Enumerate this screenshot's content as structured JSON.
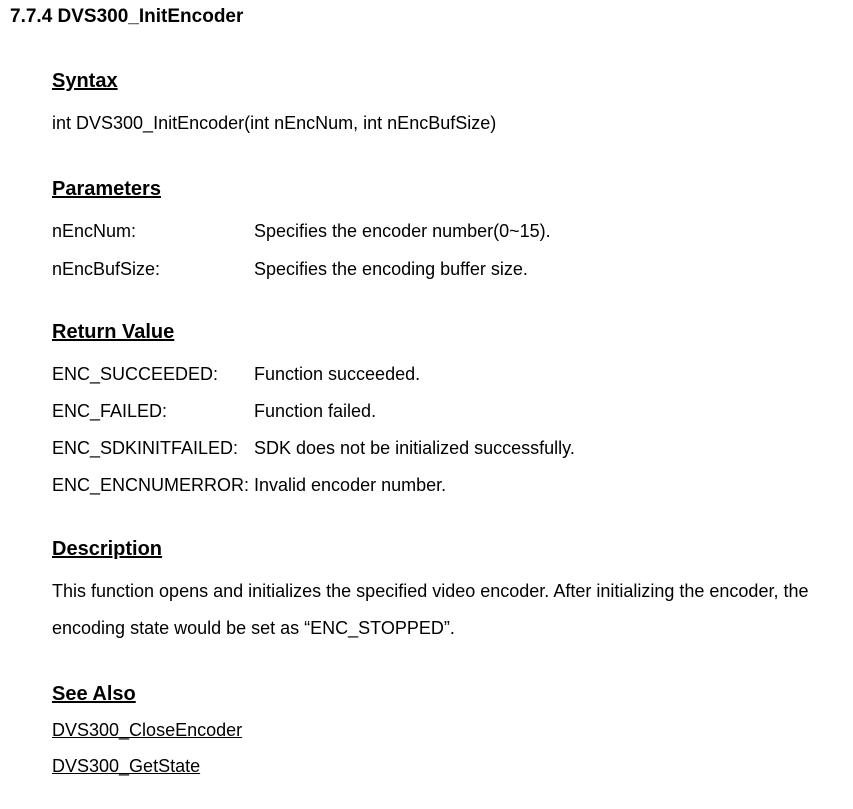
{
  "title": "7.7.4 DVS300_InitEncoder",
  "syntax": {
    "heading": "Syntax",
    "line": "int DVS300_InitEncoder(int nEncNum, int nEncBufSize)"
  },
  "parameters": {
    "heading": "Parameters",
    "rows": [
      {
        "name": "nEncNum:",
        "desc": "Specifies the encoder number(0~15)."
      },
      {
        "name": "nEncBufSize:",
        "desc": "Specifies the encoding buffer size."
      }
    ]
  },
  "returnValue": {
    "heading": "Return Value",
    "rows": [
      {
        "name": "ENC_SUCCEEDED:",
        "desc": "Function succeeded."
      },
      {
        "name": "ENC_FAILED:",
        "desc": "Function failed."
      },
      {
        "name": "ENC_SDKINITFAILED:",
        "desc": "SDK does not be initialized successfully."
      },
      {
        "name": "ENC_ENCNUMERROR:",
        "desc": "Invalid encoder number."
      }
    ]
  },
  "description": {
    "heading": "Description",
    "text": "This function opens and initializes the specified video encoder. After initializing the encoder, the encoding state would be set as “ENC_STOPPED”."
  },
  "seeAlso": {
    "heading": "See Also",
    "links": [
      "DVS300_CloseEncoder",
      "DVS300_GetState"
    ]
  }
}
